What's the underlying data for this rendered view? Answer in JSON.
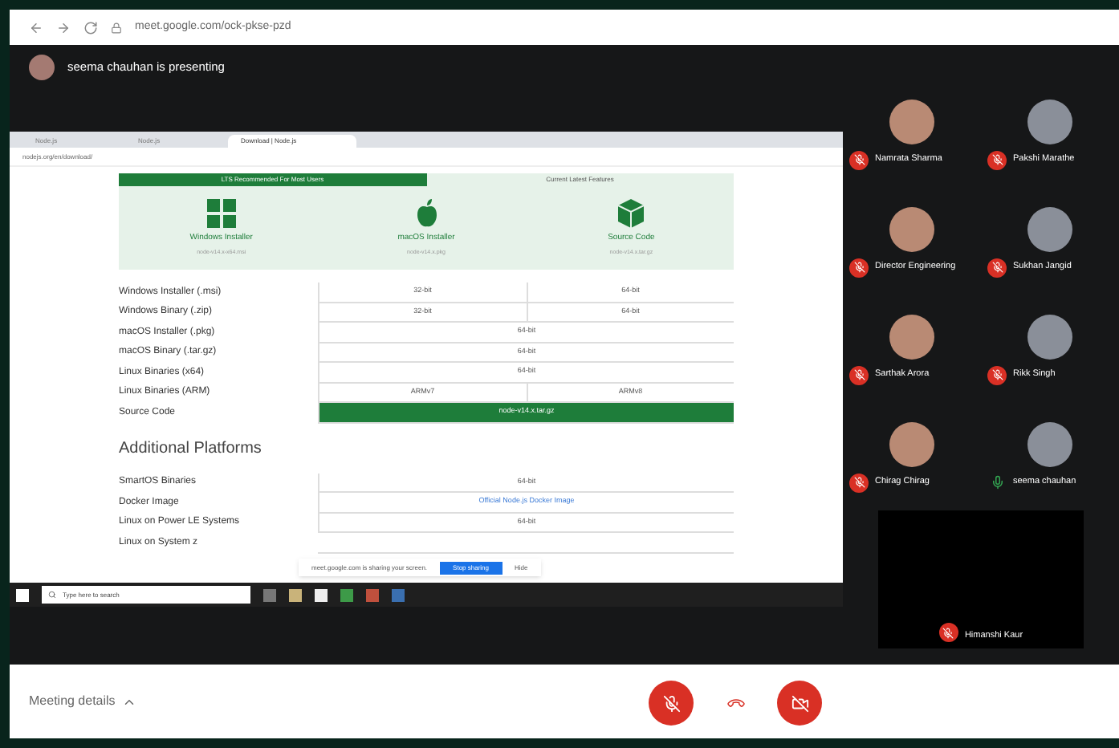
{
  "browser": {
    "url": "meet.google.com/ock-pkse-pzd"
  },
  "presenter": {
    "text": "seema chauhan is presenting"
  },
  "shared_screen": {
    "tabs": [
      {
        "label": "Node.js",
        "selected": false
      },
      {
        "label": "Node.js",
        "selected": false
      },
      {
        "label": "Download | Node.js",
        "selected": true
      }
    ],
    "url": "nodejs.org/en/download/",
    "download_tabs": [
      {
        "label": "LTS Recommended For Most Users",
        "selected": true
      },
      {
        "label": "Current Latest Features",
        "selected": false
      }
    ],
    "cards": [
      {
        "kind": "windows",
        "label": "Windows Installer",
        "sub": "node-v14.x-x64.msi"
      },
      {
        "kind": "apple",
        "label": "macOS Installer",
        "sub": "node-v14.x.pkg"
      },
      {
        "kind": "box",
        "label": "Source Code",
        "sub": "node-v14.x.tar.gz"
      }
    ],
    "rows": [
      {
        "label": "Windows Installer (.msi)",
        "cells": [
          "32-bit",
          "64-bit"
        ]
      },
      {
        "label": "Windows Binary (.zip)",
        "cells": [
          "32-bit",
          "64-bit"
        ]
      },
      {
        "label": "macOS Installer (.pkg)",
        "cells": [
          "64-bit"
        ]
      },
      {
        "label": "macOS Binary (.tar.gz)",
        "cells": [
          "64-bit"
        ]
      },
      {
        "label": "Linux Binaries (x64)",
        "cells": [
          "64-bit"
        ]
      },
      {
        "label": "Linux Binaries (ARM)",
        "cells": [
          "ARMv7",
          "ARMv8"
        ]
      },
      {
        "label": "Source Code",
        "cells": [
          "node-v14.x.tar.gz"
        ],
        "kind": "highlight"
      }
    ],
    "section_title": "Additional Platforms",
    "extra_rows": [
      {
        "label": "SmartOS Binaries",
        "cells": [
          "64-bit"
        ]
      },
      {
        "label": "Docker Image",
        "cells": [
          "Official Node.js Docker Image"
        ],
        "kind": "link"
      },
      {
        "label": "Linux on Power LE Systems",
        "cells": [
          "64-bit"
        ]
      },
      {
        "label": "Linux on System z",
        "cells": []
      }
    ],
    "sharing_bar": {
      "text": "meet.google.com is sharing your screen.",
      "stop": "Stop sharing",
      "hide": "Hide"
    },
    "taskbar": {
      "search": "Type here to search"
    }
  },
  "participants": [
    {
      "name": "Namrata Sharma",
      "muted": true
    },
    {
      "name": "Pakshi Marathe",
      "muted": true
    },
    {
      "name": "Director Engineering",
      "muted": true
    },
    {
      "name": "Sukhan Jangid",
      "muted": true
    },
    {
      "name": "Sarthak Arora",
      "muted": true
    },
    {
      "name": "Rikk Singh",
      "muted": true
    },
    {
      "name": "Chirag Chirag",
      "muted": true
    },
    {
      "name": "seema chauhan",
      "muted": false
    }
  ],
  "spotlight": {
    "name": "Himanshi Kaur",
    "muted": true
  },
  "footer": {
    "meeting_details": "Meeting details",
    "mic_muted": true,
    "camera_off": true
  }
}
